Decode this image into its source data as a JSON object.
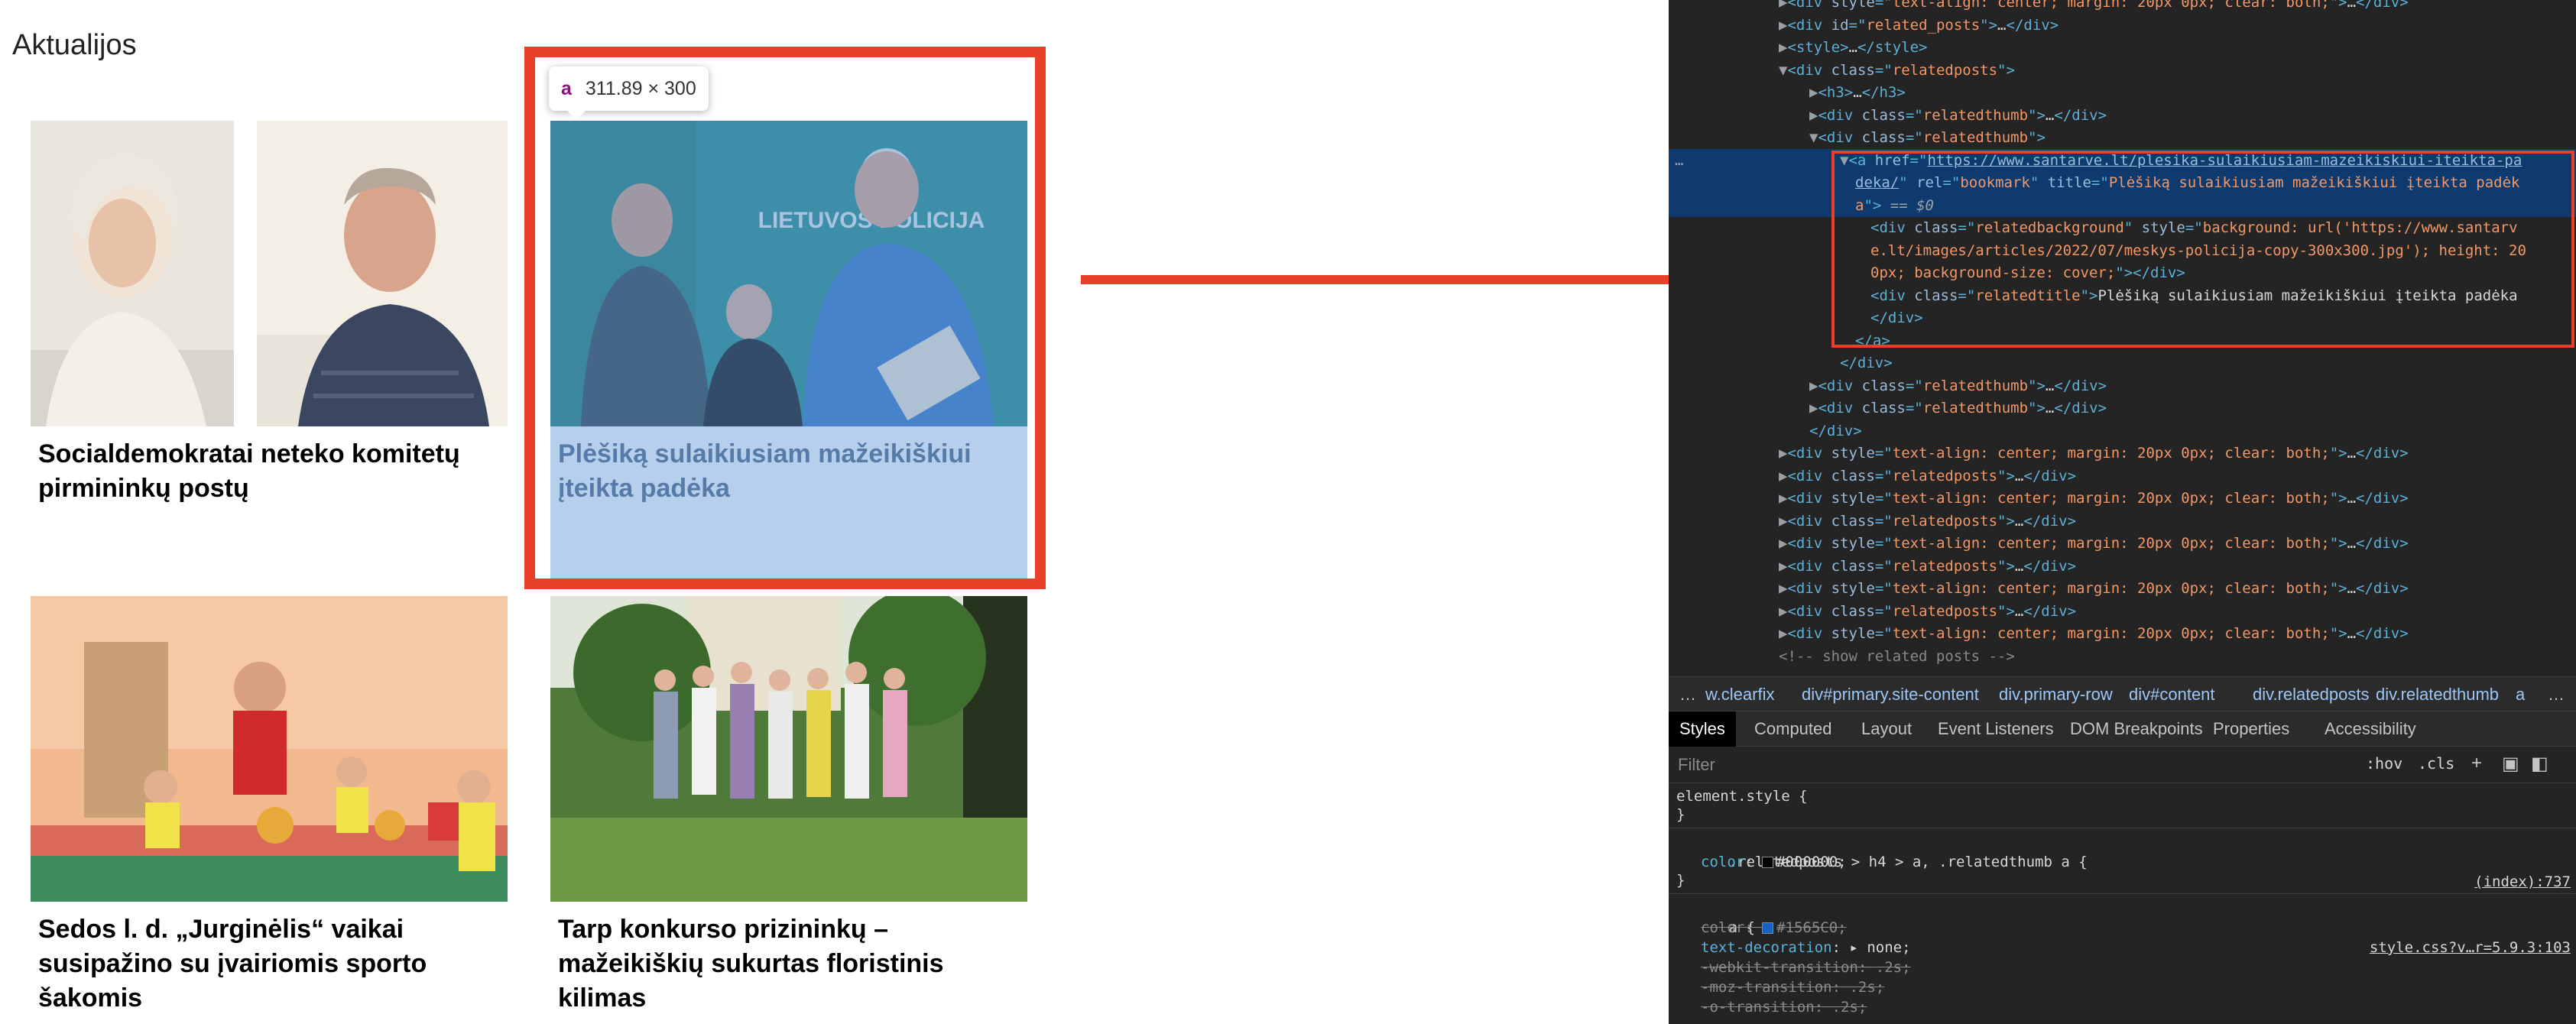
{
  "page": {
    "section_title": "Aktualijos",
    "tooltip": {
      "tag": "a",
      "size": "311.89 × 300"
    },
    "thumbs": [
      {
        "title": "Socialdemokratai neteko komitetų pirmininkų postų"
      },
      {
        "title": "Plėšiką sulaikiusiam mažeikiškiui įteikta padėka",
        "highlighted": true,
        "sign_text": "LIETUVOS POLICIJA"
      },
      {
        "title": "Sedos l. d. „Jurginėlis“ vaikai susipažino su įvairiomis sporto šakomis"
      },
      {
        "title": "Tarp konkurso prizininkų – mažeikiškių sukurtas floristinis kilimas"
      }
    ]
  },
  "devtools": {
    "dom_lines": [
      {
        "indent": 6,
        "tri": "▶",
        "parts": [
          [
            "t",
            "<div "
          ],
          [
            "an",
            "style"
          ],
          [
            "t",
            "=\""
          ],
          [
            "av",
            "text-align: center; margin: 20px 0px; clear: both;"
          ],
          [
            "t",
            "\">"
          ],
          [
            "tx",
            "…"
          ],
          [
            "t",
            "</div>"
          ]
        ]
      },
      {
        "indent": 6,
        "tri": "▶",
        "parts": [
          [
            "t",
            "<div "
          ],
          [
            "an",
            "id"
          ],
          [
            "t",
            "=\""
          ],
          [
            "av",
            "related_posts"
          ],
          [
            "t",
            "\">"
          ],
          [
            "tx",
            "…"
          ],
          [
            "t",
            "</div>"
          ]
        ]
      },
      {
        "indent": 6,
        "tri": "▶",
        "parts": [
          [
            "t",
            "<style>"
          ],
          [
            "tx",
            "…"
          ],
          [
            "t",
            "</style>"
          ]
        ]
      },
      {
        "indent": 6,
        "tri": "▼",
        "parts": [
          [
            "t",
            "<div "
          ],
          [
            "an",
            "class"
          ],
          [
            "t",
            "=\""
          ],
          [
            "av",
            "relatedposts"
          ],
          [
            "t",
            "\">"
          ]
        ]
      },
      {
        "indent": 8,
        "tri": "▶",
        "parts": [
          [
            "t",
            "<h3>"
          ],
          [
            "tx",
            "…"
          ],
          [
            "t",
            "</h3>"
          ]
        ]
      },
      {
        "indent": 8,
        "tri": "▶",
        "parts": [
          [
            "t",
            "<div "
          ],
          [
            "an",
            "class"
          ],
          [
            "t",
            "=\""
          ],
          [
            "av",
            "relatedthumb"
          ],
          [
            "t",
            "\">"
          ],
          [
            "tx",
            "…"
          ],
          [
            "t",
            "</div>"
          ]
        ]
      },
      {
        "indent": 8,
        "tri": "▼",
        "parts": [
          [
            "t",
            "<div "
          ],
          [
            "an",
            "class"
          ],
          [
            "t",
            "=\""
          ],
          [
            "av",
            "relatedthumb"
          ],
          [
            "t",
            "\">"
          ]
        ]
      },
      {
        "indent": 10,
        "tri": "▼",
        "sel": true,
        "parts": [
          [
            "t",
            "<a "
          ],
          [
            "an",
            "href"
          ],
          [
            "t",
            "=\""
          ],
          [
            "avl",
            "https://www.santarve.lt/plesika-sulaikiusiam-mazeikiskiui-iteikta-pa"
          ]
        ]
      },
      {
        "indent": 11,
        "tri": "",
        "sel": true,
        "parts": [
          [
            "avl",
            "deka/"
          ],
          [
            "t",
            "\" "
          ],
          [
            "an",
            "rel"
          ],
          [
            "t",
            "=\""
          ],
          [
            "av",
            "bookmark"
          ],
          [
            "t",
            "\" "
          ],
          [
            "an",
            "title"
          ],
          [
            "t",
            "=\""
          ],
          [
            "av",
            "Plėšiką sulaikiusiam mažeikiškiui įteikta padėk"
          ]
        ]
      },
      {
        "indent": 11,
        "tri": "",
        "sel": true,
        "parts": [
          [
            "av",
            "a"
          ],
          [
            "t",
            "\">"
          ],
          [
            "dollar",
            " == $0"
          ]
        ]
      },
      {
        "indent": 12,
        "tri": "",
        "parts": [
          [
            "t",
            "<div "
          ],
          [
            "an",
            "class"
          ],
          [
            "t",
            "=\""
          ],
          [
            "av",
            "relatedbackground"
          ],
          [
            "t",
            "\" "
          ],
          [
            "an",
            "style"
          ],
          [
            "t",
            "=\""
          ],
          [
            "av",
            "background: url('https://www.santarv"
          ]
        ]
      },
      {
        "indent": 12,
        "tri": "",
        "parts": [
          [
            "av",
            "e.lt/images/articles/2022/07/meskys-policija-copy-300x300.jpg'); height: 20"
          ]
        ]
      },
      {
        "indent": 12,
        "tri": "",
        "parts": [
          [
            "av",
            "0px; background-size: cover;"
          ],
          [
            "t",
            "\"></div>"
          ]
        ]
      },
      {
        "indent": 12,
        "tri": "",
        "parts": [
          [
            "t",
            "<div "
          ],
          [
            "an",
            "class"
          ],
          [
            "t",
            "=\""
          ],
          [
            "av",
            "relatedtitle"
          ],
          [
            "t",
            "\">"
          ],
          [
            "tx",
            "Plėšiką sulaikiusiam mažeikiškiui įteikta padėka"
          ]
        ]
      },
      {
        "indent": 12,
        "tri": "",
        "parts": [
          [
            "t",
            "</div>"
          ]
        ]
      },
      {
        "indent": 11,
        "tri": "",
        "parts": [
          [
            "t",
            "</a>"
          ]
        ]
      },
      {
        "indent": 10,
        "tri": "",
        "parts": [
          [
            "t",
            "</div>"
          ]
        ]
      },
      {
        "indent": 8,
        "tri": "▶",
        "parts": [
          [
            "t",
            "<div "
          ],
          [
            "an",
            "class"
          ],
          [
            "t",
            "=\""
          ],
          [
            "av",
            "relatedthumb"
          ],
          [
            "t",
            "\">"
          ],
          [
            "tx",
            "…"
          ],
          [
            "t",
            "</div>"
          ]
        ]
      },
      {
        "indent": 8,
        "tri": "▶",
        "parts": [
          [
            "t",
            "<div "
          ],
          [
            "an",
            "class"
          ],
          [
            "t",
            "=\""
          ],
          [
            "av",
            "relatedthumb"
          ],
          [
            "t",
            "\">"
          ],
          [
            "tx",
            "…"
          ],
          [
            "t",
            "</div>"
          ]
        ]
      },
      {
        "indent": 8,
        "tri": "",
        "parts": [
          [
            "t",
            "</div>"
          ]
        ]
      },
      {
        "indent": 6,
        "tri": "▶",
        "parts": [
          [
            "t",
            "<div "
          ],
          [
            "an",
            "style"
          ],
          [
            "t",
            "=\""
          ],
          [
            "av",
            "text-align: center; margin: 20px 0px; clear: both;"
          ],
          [
            "t",
            "\">"
          ],
          [
            "tx",
            "…"
          ],
          [
            "t",
            "</div>"
          ]
        ]
      },
      {
        "indent": 6,
        "tri": "▶",
        "parts": [
          [
            "t",
            "<div "
          ],
          [
            "an",
            "class"
          ],
          [
            "t",
            "=\""
          ],
          [
            "av",
            "relatedposts"
          ],
          [
            "t",
            "\">"
          ],
          [
            "tx",
            "…"
          ],
          [
            "t",
            "</div>"
          ]
        ]
      },
      {
        "indent": 6,
        "tri": "▶",
        "parts": [
          [
            "t",
            "<div "
          ],
          [
            "an",
            "style"
          ],
          [
            "t",
            "=\""
          ],
          [
            "av",
            "text-align: center; margin: 20px 0px; clear: both;"
          ],
          [
            "t",
            "\">"
          ],
          [
            "tx",
            "…"
          ],
          [
            "t",
            "</div>"
          ]
        ]
      },
      {
        "indent": 6,
        "tri": "▶",
        "parts": [
          [
            "t",
            "<div "
          ],
          [
            "an",
            "class"
          ],
          [
            "t",
            "=\""
          ],
          [
            "av",
            "relatedposts"
          ],
          [
            "t",
            "\">"
          ],
          [
            "tx",
            "…"
          ],
          [
            "t",
            "</div>"
          ]
        ]
      },
      {
        "indent": 6,
        "tri": "▶",
        "parts": [
          [
            "t",
            "<div "
          ],
          [
            "an",
            "style"
          ],
          [
            "t",
            "=\""
          ],
          [
            "av",
            "text-align: center; margin: 20px 0px; clear: both;"
          ],
          [
            "t",
            "\">"
          ],
          [
            "tx",
            "…"
          ],
          [
            "t",
            "</div>"
          ]
        ]
      },
      {
        "indent": 6,
        "tri": "▶",
        "parts": [
          [
            "t",
            "<div "
          ],
          [
            "an",
            "class"
          ],
          [
            "t",
            "=\""
          ],
          [
            "av",
            "relatedposts"
          ],
          [
            "t",
            "\">"
          ],
          [
            "tx",
            "…"
          ],
          [
            "t",
            "</div>"
          ]
        ]
      },
      {
        "indent": 6,
        "tri": "▶",
        "parts": [
          [
            "t",
            "<div "
          ],
          [
            "an",
            "style"
          ],
          [
            "t",
            "=\""
          ],
          [
            "av",
            "text-align: center; margin: 20px 0px; clear: both;"
          ],
          [
            "t",
            "\">"
          ],
          [
            "tx",
            "…"
          ],
          [
            "t",
            "</div>"
          ]
        ]
      },
      {
        "indent": 6,
        "tri": "▶",
        "parts": [
          [
            "t",
            "<div "
          ],
          [
            "an",
            "class"
          ],
          [
            "t",
            "=\""
          ],
          [
            "av",
            "relatedposts"
          ],
          [
            "t",
            "\">"
          ],
          [
            "tx",
            "…"
          ],
          [
            "t",
            "</div>"
          ]
        ]
      },
      {
        "indent": 6,
        "tri": "▶",
        "parts": [
          [
            "t",
            "<div "
          ],
          [
            "an",
            "style"
          ],
          [
            "t",
            "=\""
          ],
          [
            "av",
            "text-align: center; margin: 20px 0px; clear: both;"
          ],
          [
            "t",
            "\">"
          ],
          [
            "tx",
            "…"
          ],
          [
            "t",
            "</div>"
          ]
        ]
      },
      {
        "indent": 6,
        "tri": "",
        "parts": [
          [
            "cm",
            "<!-- show related posts -->"
          ]
        ]
      }
    ],
    "breadcrumbs": [
      "…",
      "w.clearfix",
      "div#primary.site-content",
      "div.primary-row",
      "div#content",
      "div.relatedposts",
      "div.relatedthumb",
      "a",
      "…"
    ],
    "tabs": [
      "Styles",
      "Computed",
      "Layout",
      "Event Listeners",
      "DOM Breakpoints",
      "Properties",
      "Accessibility"
    ],
    "filter": {
      "placeholder": "Filter",
      "hov": ":hov",
      "cls": ".cls"
    },
    "styles": {
      "element_style": "element.style {",
      "rule1_selector": ".relatedposts > h4 > a, .relatedthumb a {",
      "rule1_source": "(index):737",
      "rule1_color_prop": "color",
      "rule1_color_value": "#000000;",
      "rule2_selector": "a {",
      "rule2_source": "style.css?v…r=5.9.3:103",
      "rule2_color_value": "#1565C0;",
      "rule2_decoration": "none;",
      "rule2_webkit": ".2s;",
      "rule2_moz": ".2s;",
      "rule2_o": ".2s;"
    },
    "colors": {
      "black_swatch": "#000000",
      "blue_swatch": "#1565C0"
    }
  }
}
